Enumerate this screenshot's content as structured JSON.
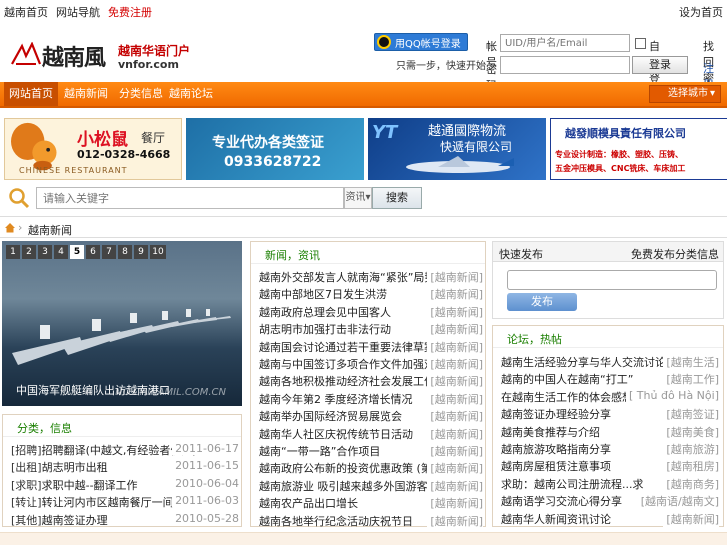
{
  "topbar": {
    "links": [
      "越南首页",
      "网站导航",
      "免费注册"
    ],
    "right": "设为首页"
  },
  "logo": {
    "name": "越南風",
    "tagline": "越南华语门户",
    "domain": "vnfor.com"
  },
  "qq": {
    "button": "用QQ帐号登录",
    "hint": "只需一步，快速开始"
  },
  "login": {
    "user_label": "帐号",
    "user_placeholder": "UID/用户名/Email",
    "remember": "自动登录",
    "forgot": "找回密码",
    "pass_label": "密码",
    "submit": "登录",
    "register": "注册"
  },
  "nav": {
    "items": [
      "网站首页",
      "越南新闻",
      "分类信息",
      "越南论坛"
    ],
    "city": "选择城市"
  },
  "banners": {
    "b1": {
      "title": "小松鼠",
      "sub": "餐厅",
      "phone": "012-0328-4668",
      "en": "CHINESE RESTAURANT"
    },
    "b2": {
      "title": "专业代办各类签证",
      "phone": "0933628722"
    },
    "b3": {
      "logo": "YT",
      "line1": "越通國際物流",
      "line2": "快遞有限公司"
    },
    "b4": {
      "title": "越發順模具責任有限公司",
      "line1": "专业设计制造：橡胶、塑胶、压铸、",
      "line2": "五金冲压模具、CNC铣床、车床加工"
    }
  },
  "search": {
    "placeholder": "请输入关键字",
    "scope": "资讯",
    "button": "搜索"
  },
  "breadcrumb": {
    "current": "越南新闻"
  },
  "slideshow": {
    "numbers": [
      "1",
      "2",
      "3",
      "4",
      "5",
      "6",
      "7",
      "8",
      "9",
      "10"
    ],
    "active": 5,
    "caption": "中国海军舰艇编队出访越南港口",
    "watermark": "NC.CHINAMIL.COM.CN"
  },
  "news": {
    "title": "新闻，资讯",
    "items": [
      {
        "t": "越南外交部发言人就南海“紧张”局势表态",
        "tag": "[越南新闻]"
      },
      {
        "t": "越南中部地区7日发生洪涝",
        "tag": "[越南新闻]"
      },
      {
        "t": "越南政府总理会见中国客人",
        "tag": "[越南新闻]"
      },
      {
        "t": "胡志明市加强打击非法行动",
        "tag": "[越南新闻]"
      },
      {
        "t": "越南国会讨论通过若干重要法律草案修订",
        "tag": "[越南新闻]"
      },
      {
        "t": "越南与中国签订多项合作文件加强双边关系",
        "tag": "[越南新闻]"
      },
      {
        "t": "越南各地积极推动经济社会发展工作的部署安排",
        "tag": "[越南新闻]"
      },
      {
        "t": "越南今年第2 季度经济增长情况",
        "tag": "[越南新闻]"
      },
      {
        "t": "越南举办国际经济贸易展览会",
        "tag": "[越南新闻]"
      },
      {
        "t": "越南华人社区庆祝传统节日活动",
        "tag": "[越南新闻]"
      },
      {
        "t": "越南“一带一路”合作项目",
        "tag": "[越南新闻]"
      },
      {
        "t": "越南政府公布新的投资优惠政策 (第二部分)",
        "tag": "[越南新闻]"
      },
      {
        "t": "越南旅游业 吸引越来越多外国游客",
        "tag": "[越南新闻]"
      },
      {
        "t": "越南农产品出口增长",
        "tag": "[越南新闻]"
      },
      {
        "t": "越南各地举行纪念活动庆祝节日",
        "tag": "[越南新闻]"
      }
    ]
  },
  "left_list": {
    "title": "分类，信息",
    "items": [
      {
        "tag": "[招聘]",
        "t": "招聘翻译(中越文,有经验者优先)",
        "date": "2011-06-17"
      },
      {
        "tag": "[出租]",
        "t": "胡志明市出租",
        "date": "2011-06-15"
      },
      {
        "tag": "[求职]",
        "t": "求职中越--翻译工作",
        "date": "2010-06-04"
      },
      {
        "tag": "[转让]",
        "t": "转让河内市区越南餐厅一间",
        "date": "2011-06-03"
      },
      {
        "tag": "[其他]",
        "t": "越南签证办理",
        "date": "2010-05-28"
      }
    ]
  },
  "quick": {
    "title": "快速发布",
    "right": "免费发布分类信息",
    "button": "发布"
  },
  "right_list": {
    "title": "论坛，热帖",
    "items": [
      {
        "t": "越南生活经验分享与华人交流讨论",
        "tag": "[越南生活]"
      },
      {
        "t": "越南的中国人在越南“打工”",
        "tag": "[越南工作]"
      },
      {
        "t": "在越南生活工作的体会感想",
        "tag": "[ Thủ đô Hà Nội]"
      },
      {
        "t": "越南签证办理经验分享",
        "tag": "[越南签证]"
      },
      {
        "t": "越南美食推荐与介绍",
        "tag": "[越南美食]"
      },
      {
        "t": "越南旅游攻略指南分享",
        "tag": "[越南旅游]"
      },
      {
        "t": "越南房屋租赁注意事项",
        "tag": "[越南租房]"
      },
      {
        "t": "求助：越南公司注册流程...求",
        "tag": "[越南商务]"
      },
      {
        "t": "越南语学习交流心得分享",
        "tag": "[越南语/越南文]"
      },
      {
        "t": "越南华人新闻资讯讨论",
        "tag": "[越南新闻]"
      }
    ]
  }
}
